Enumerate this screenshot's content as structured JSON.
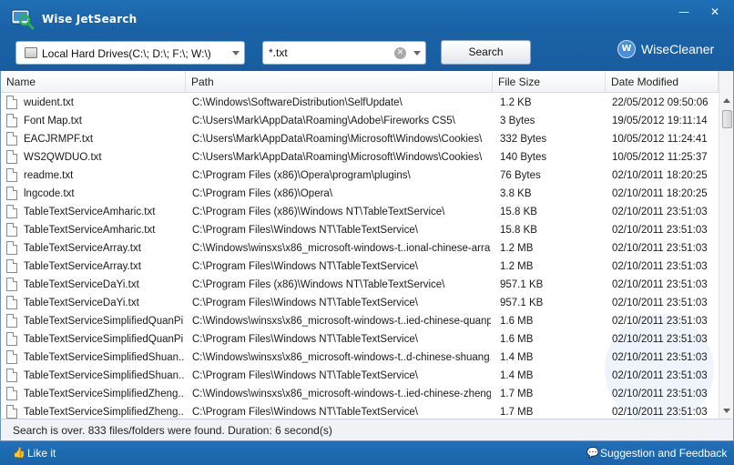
{
  "window": {
    "title": "Wise JetSearch",
    "minimize_glyph": "—",
    "close_glyph": "✕"
  },
  "toolbar": {
    "drive_select_value": "Local Hard Drives(C:\\; D:\\; F:\\; W:\\)",
    "search_value": "*.txt",
    "clear_glyph": "✕",
    "search_button_label": "Search",
    "brand_logo_letter": "W",
    "brand_name": "WiseCleaner"
  },
  "colors": {
    "titlebar": "#1b63a8",
    "footer": "#1b63a8",
    "accent": "#4a8fd6"
  },
  "columns": [
    "Name",
    "Path",
    "File Size",
    "Date Modified"
  ],
  "rows": [
    {
      "name": "wuident.txt",
      "path": "C:\\Windows\\SoftwareDistribution\\SelfUpdate\\",
      "size": "1.2 KB",
      "date": "22/05/2012 09:50:06"
    },
    {
      "name": "Font Map.txt",
      "path": "C:\\Users\\Mark\\AppData\\Roaming\\Adobe\\Fireworks CS5\\",
      "size": "3 Bytes",
      "date": "19/05/2012 19:11:14"
    },
    {
      "name": "EACJRMPF.txt",
      "path": "C:\\Users\\Mark\\AppData\\Roaming\\Microsoft\\Windows\\Cookies\\",
      "size": "332 Bytes",
      "date": "10/05/2012 11:24:41"
    },
    {
      "name": "WS2QWDUO.txt",
      "path": "C:\\Users\\Mark\\AppData\\Roaming\\Microsoft\\Windows\\Cookies\\",
      "size": "140 Bytes",
      "date": "10/05/2012 11:25:37"
    },
    {
      "name": "readme.txt",
      "path": "C:\\Program Files (x86)\\Opera\\program\\plugins\\",
      "size": "76 Bytes",
      "date": "02/10/2011 18:20:25"
    },
    {
      "name": "lngcode.txt",
      "path": "C:\\Program Files (x86)\\Opera\\",
      "size": "3.8 KB",
      "date": "02/10/2011 18:20:25"
    },
    {
      "name": "TableTextServiceAmharic.txt",
      "path": "C:\\Program Files (x86)\\Windows NT\\TableTextService\\",
      "size": "15.8 KB",
      "date": "02/10/2011 23:51:03"
    },
    {
      "name": "TableTextServiceAmharic.txt",
      "path": "C:\\Program Files\\Windows NT\\TableTextService\\",
      "size": "15.8 KB",
      "date": "02/10/2011 23:51:03"
    },
    {
      "name": "TableTextServiceArray.txt",
      "path": "C:\\Windows\\winsxs\\x86_microsoft-windows-t..ional-chinese-arra...",
      "size": "1.2 MB",
      "date": "02/10/2011 23:51:03"
    },
    {
      "name": "TableTextServiceArray.txt",
      "path": "C:\\Program Files\\Windows NT\\TableTextService\\",
      "size": "1.2 MB",
      "date": "02/10/2011 23:51:03"
    },
    {
      "name": "TableTextServiceDaYi.txt",
      "path": "C:\\Program Files (x86)\\Windows NT\\TableTextService\\",
      "size": "957.1 KB",
      "date": "02/10/2011 23:51:03"
    },
    {
      "name": "TableTextServiceDaYi.txt",
      "path": "C:\\Program Files\\Windows NT\\TableTextService\\",
      "size": "957.1 KB",
      "date": "02/10/2011 23:51:03"
    },
    {
      "name": "TableTextServiceSimplifiedQuanPi...",
      "path": "C:\\Windows\\winsxs\\x86_microsoft-windows-t..ied-chinese-quanp...",
      "size": "1.6 MB",
      "date": "02/10/2011 23:51:03"
    },
    {
      "name": "TableTextServiceSimplifiedQuanPi...",
      "path": "C:\\Program Files\\Windows NT\\TableTextService\\",
      "size": "1.6 MB",
      "date": "02/10/2011 23:51:03"
    },
    {
      "name": "TableTextServiceSimplifiedShuan...",
      "path": "C:\\Windows\\winsxs\\x86_microsoft-windows-t..d-chinese-shuang...",
      "size": "1.4 MB",
      "date": "02/10/2011 23:51:03"
    },
    {
      "name": "TableTextServiceSimplifiedShuan...",
      "path": "C:\\Program Files\\Windows NT\\TableTextService\\",
      "size": "1.4 MB",
      "date": "02/10/2011 23:51:03"
    },
    {
      "name": "TableTextServiceSimplifiedZheng...",
      "path": "C:\\Windows\\winsxs\\x86_microsoft-windows-t..ied-chinese-zheng...",
      "size": "1.7 MB",
      "date": "02/10/2011 23:51:03"
    },
    {
      "name": "TableTextServiceSimplifiedZheng...",
      "path": "C:\\Program Files\\Windows NT\\TableTextService\\",
      "size": "1.7 MB",
      "date": "02/10/2011 23:51:03"
    }
  ],
  "status": {
    "text": "Search is over. 833 files/folders were found. Duration: 6 second(s)"
  },
  "footer": {
    "like_icon": "thumbs-up-icon",
    "like_label": "Like it",
    "feedback_icon": "speech-bubble-icon",
    "feedback_label": "Suggestion and Feedback"
  }
}
